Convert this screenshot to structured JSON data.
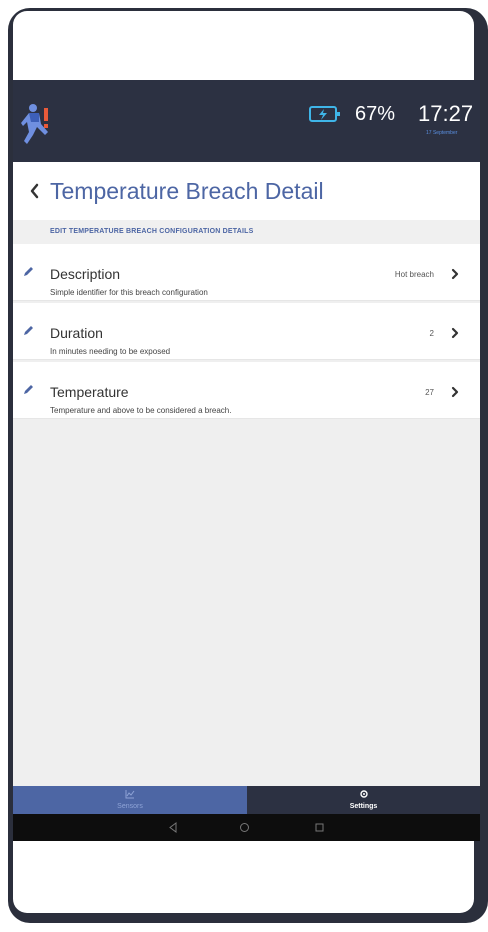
{
  "status": {
    "battery": "67%",
    "time": "17:27",
    "date": "17 September"
  },
  "header": {
    "title": "Temperature Breach Detail"
  },
  "section": {
    "label": "EDIT TEMPERATURE BREACH CONFIGURATION DETAILS"
  },
  "rows": [
    {
      "title": "Description",
      "subtitle": "Simple identifier for this breach configuration",
      "value": "Hot breach"
    },
    {
      "title": "Duration",
      "subtitle": "In minutes needing to be exposed",
      "value": "2"
    },
    {
      "title": "Temperature",
      "subtitle": "Temperature and above to be considered a breach.",
      "value": "27"
    }
  ],
  "tabs": [
    {
      "label": "Sensors",
      "icon": "chart-icon",
      "active": false
    },
    {
      "label": "Settings",
      "icon": "gear-icon",
      "active": true
    }
  ],
  "colors": {
    "accent": "#4d66a4",
    "statusbar": "#2c3142",
    "background": "#efefef"
  }
}
